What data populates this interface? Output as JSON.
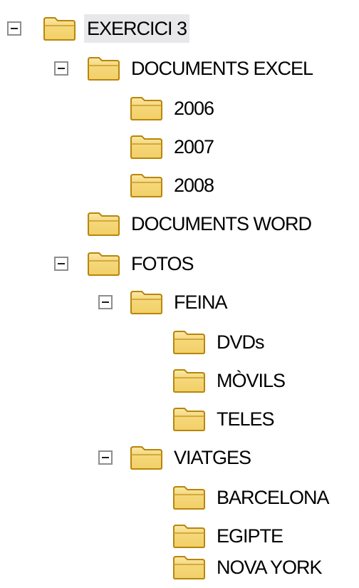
{
  "tree": {
    "items": [
      {
        "label": "EXERCICI 3",
        "expanded": true,
        "selected": true
      },
      {
        "label": "DOCUMENTS EXCEL",
        "expanded": true
      },
      {
        "label": "2006"
      },
      {
        "label": "2007"
      },
      {
        "label": "2008"
      },
      {
        "label": "DOCUMENTS WORD"
      },
      {
        "label": "FOTOS",
        "expanded": true
      },
      {
        "label": "FEINA",
        "expanded": true
      },
      {
        "label": "DVDs"
      },
      {
        "label": "MÒVILS"
      },
      {
        "label": "TELES"
      },
      {
        "label": "VIATGES",
        "expanded": true
      },
      {
        "label": "BARCELONA"
      },
      {
        "label": "EGIPTE"
      },
      {
        "label": "NOVA YORK"
      }
    ]
  },
  "colors": {
    "folder_fill": "#f3d36b",
    "folder_stroke": "#b8860b",
    "selection_bg": "#e8e8ea",
    "toggle_border": "#8d8d8d"
  },
  "icons": {
    "folder": "folder-icon",
    "toggle": "collapse-toggle-icon"
  }
}
